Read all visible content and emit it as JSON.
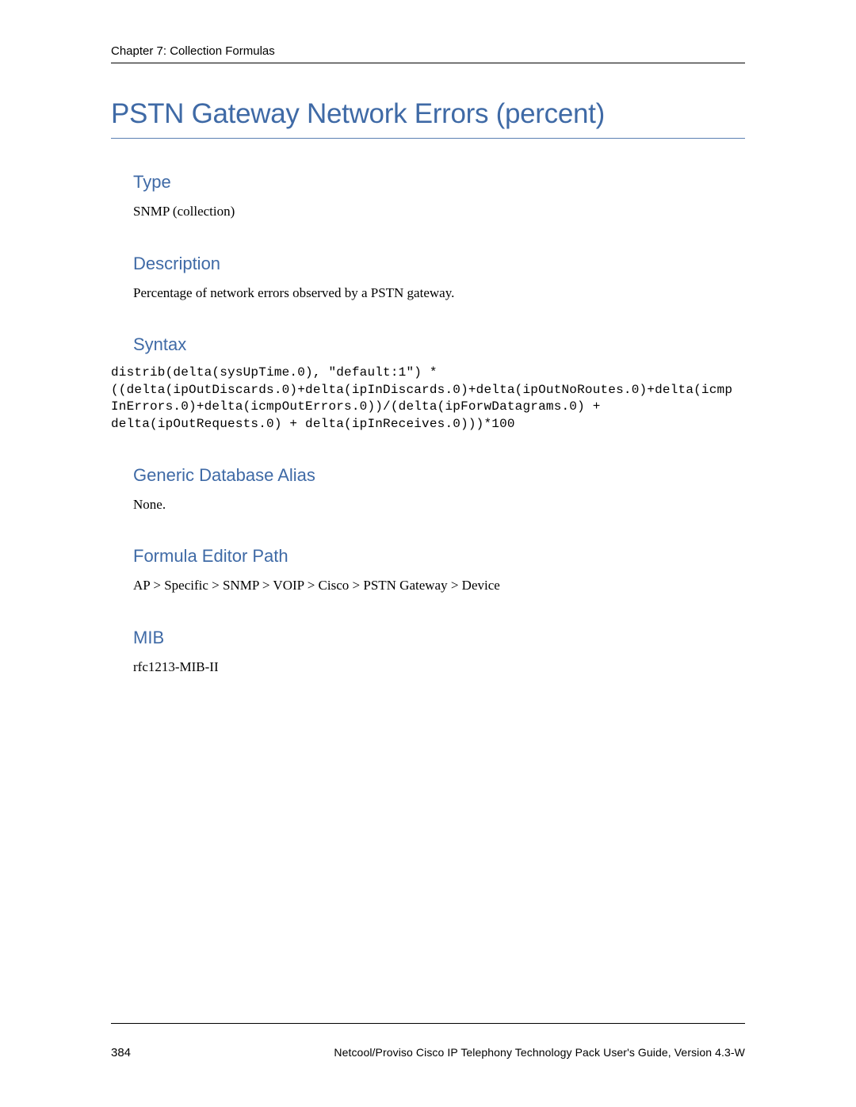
{
  "header": {
    "running_head": "Chapter 7: Collection Formulas"
  },
  "title": "PSTN Gateway Network Errors (percent)",
  "sections": {
    "type": {
      "heading": "Type",
      "body": "SNMP (collection)"
    },
    "description": {
      "heading": "Description",
      "body": "Percentage of network errors observed by a PSTN gateway."
    },
    "syntax": {
      "heading": "Syntax",
      "code": "distrib(delta(sysUpTime.0), \"default:1\") *\n((delta(ipOutDiscards.0)+delta(ipInDiscards.0)+delta(ipOutNoRoutes.0)+delta(icmp\nInErrors.0)+delta(icmpOutErrors.0))/(delta(ipForwDatagrams.0) +\ndelta(ipOutRequests.0) + delta(ipInReceives.0)))*100"
    },
    "alias": {
      "heading": "Generic Database Alias",
      "body": "None."
    },
    "editor": {
      "heading": "Formula Editor Path",
      "body": "AP > Specific > SNMP > VOIP > Cisco > PSTN Gateway > Device"
    },
    "mib": {
      "heading": "MIB",
      "body": "rfc1213-MIB-II"
    }
  },
  "footer": {
    "page": "384",
    "doc": "Netcool/Proviso Cisco IP Telephony Technology Pack User's Guide, Version 4.3-W"
  }
}
